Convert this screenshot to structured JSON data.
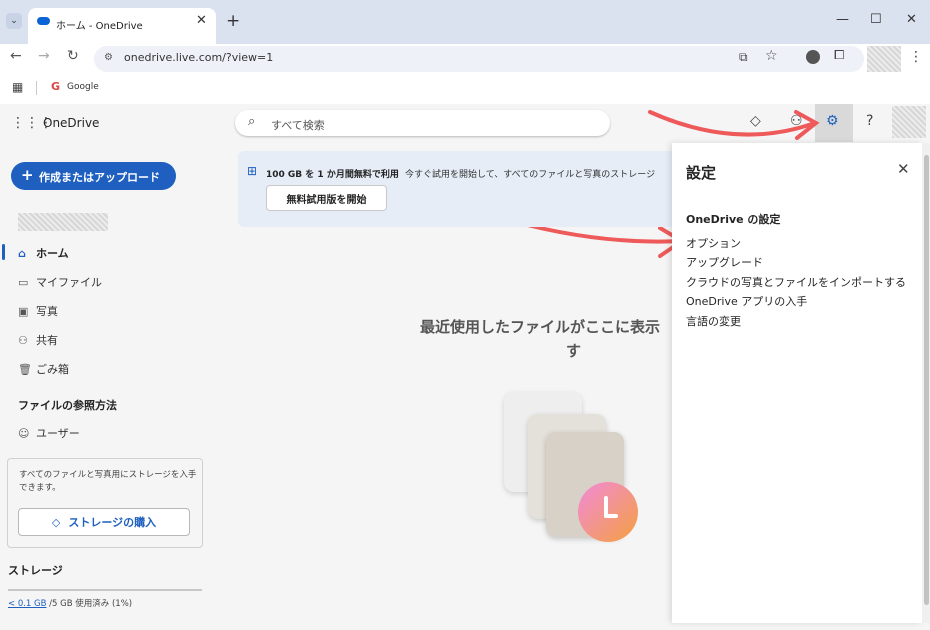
{
  "browser": {
    "tab_title": "ホーム - OneDrive",
    "url": "onedrive.live.com/?view=1",
    "bookmark_google": "Google"
  },
  "app": {
    "name": "OneDrive",
    "search_placeholder": "すべて検索",
    "create_label": "作成またはアップロード",
    "nav": {
      "home": "ホーム",
      "my_files": "マイファイル",
      "photos": "写真",
      "shared": "共有",
      "recycle": "ごみ箱"
    },
    "browse_title": "ファイルの参照方法",
    "people": "ユーザー",
    "storage_promo": "すべてのファイルと写真用にストレージを入手できます。",
    "buy_storage": "ストレージの購入",
    "storage_title": "ストレージ",
    "storage_used": "< 0.1 GB",
    "storage_total": "/5 GB 使用済み (1%)",
    "banner_title": "100 GB を 1 か月間無料で利用",
    "banner_sub": "今すぐ試用を開始して、すべてのファイルと写真のストレージ",
    "trial_button": "無料試用版を開始",
    "empty_line1": "最近使用したファイルがここに表示",
    "empty_line2": "す"
  },
  "settings": {
    "title": "設定",
    "section": "OneDrive の設定",
    "links": [
      "オプション",
      "アップグレード",
      "クラウドの写真とファイルをインポートする",
      "OneDrive アプリの入手",
      "言語の変更"
    ]
  },
  "colors": {
    "accent": "#1e5fbf",
    "annotation_arrow": "#ee5a5a"
  }
}
